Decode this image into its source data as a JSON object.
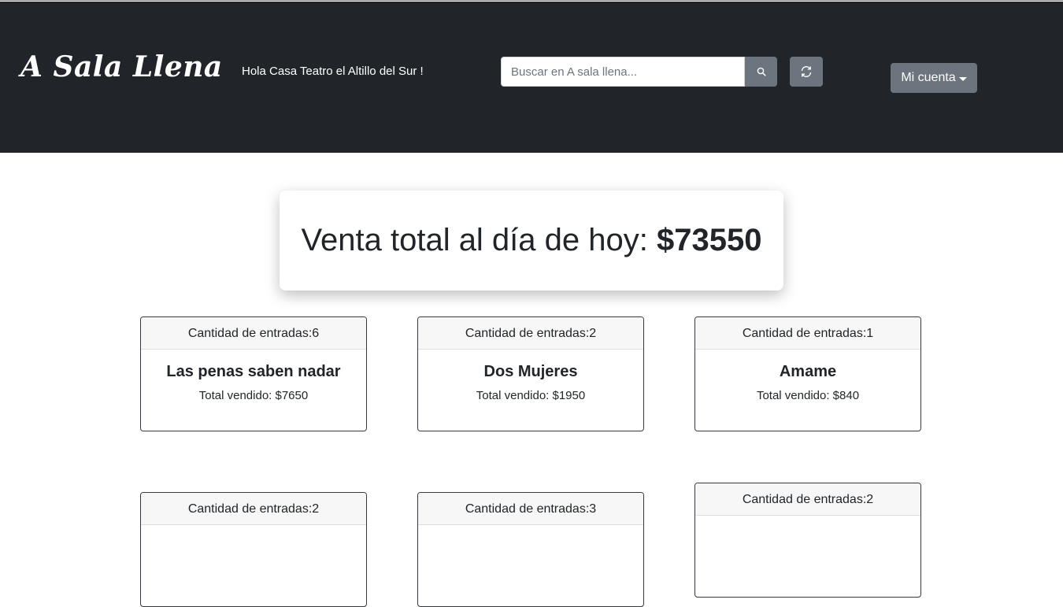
{
  "navbar": {
    "brand": "A Sala Llena",
    "greeting": "Hola Casa Teatro el Altillo del Sur !",
    "search": {
      "placeholder": "Buscar en A sala llena...",
      "value": ""
    },
    "search_button_icon": "search-icon",
    "refresh_button_icon": "refresh-icon",
    "account_label": "Mi cuenta"
  },
  "summary": {
    "label": "Venta total al día de hoy: ",
    "amount": "$73550"
  },
  "cards": [
    {
      "header": "Cantidad de entradas:6",
      "title": "Las penas saben nadar",
      "total": "Total vendido: $7650"
    },
    {
      "header": "Cantidad de entradas:2",
      "title": "Dos Mujeres",
      "total": "Total vendido: $1950"
    },
    {
      "header": "Cantidad de entradas:1",
      "title": "Amame",
      "total": "Total vendido: $840"
    },
    {
      "header": "Cantidad de entradas:2",
      "title": "",
      "total": ""
    },
    {
      "header": "Cantidad de entradas:3",
      "title": "",
      "total": ""
    },
    {
      "header": "Cantidad de entradas:2",
      "title": "",
      "total": ""
    }
  ],
  "colors": {
    "navbar_bg": "#212529",
    "button_gray": "#6c757d",
    "card_header_bg": "#f7f7f7"
  }
}
